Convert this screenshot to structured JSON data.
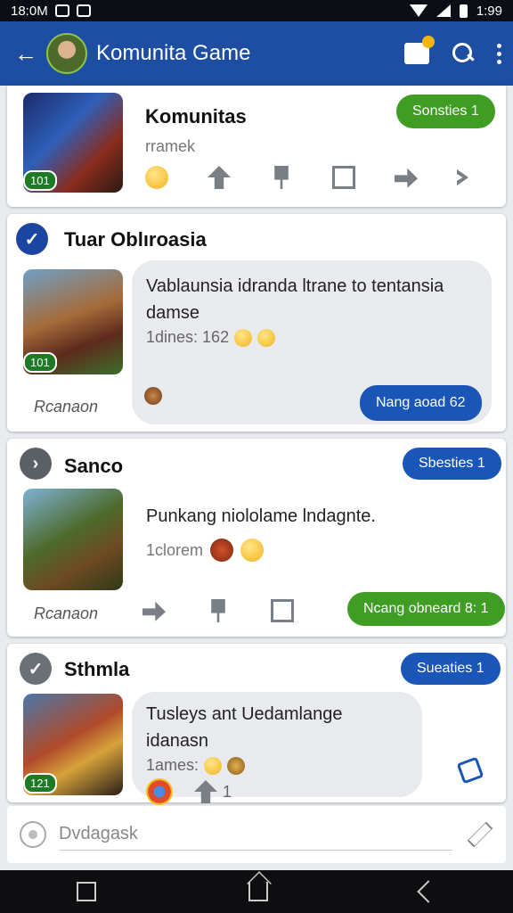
{
  "status_bar": {
    "time": "18:0M",
    "battery_text": "1:99"
  },
  "app_bar": {
    "title": "Komunita Game",
    "notification_count": "1"
  },
  "posts": [
    {
      "title": "Komunitas",
      "subtitle": "rramek",
      "pill_label": "Sonsties 1",
      "level_badge": "101"
    },
    {
      "title": "Tuar Oblıroasia",
      "level_badge": "101",
      "author": "Rcanaon",
      "message": "Vablaunsia idranda ltrane to tentansia damse",
      "meta": "1dines: 162",
      "reply_pill": "Nang aoad 62"
    },
    {
      "title": "Sanco",
      "pill_label": "Sbesties 1",
      "message": "Punkang niololame lndagnte.",
      "meta": "1clorem",
      "author": "Rcanaon",
      "reply_pill": "Ncang obneard 8: 1"
    },
    {
      "title": "Sthmla",
      "pill_label": "Sueaties 1",
      "level_badge": "121",
      "message": "Tusleys ant Uedamlange idanasn",
      "meta": "1ames:",
      "reaction_count": "1"
    }
  ],
  "compose": {
    "placeholder": "Dvdagask"
  },
  "colors": {
    "app_bar": "#1d4ea1",
    "green_pill": "#3f9d24",
    "blue_pill": "#1a56b8"
  }
}
